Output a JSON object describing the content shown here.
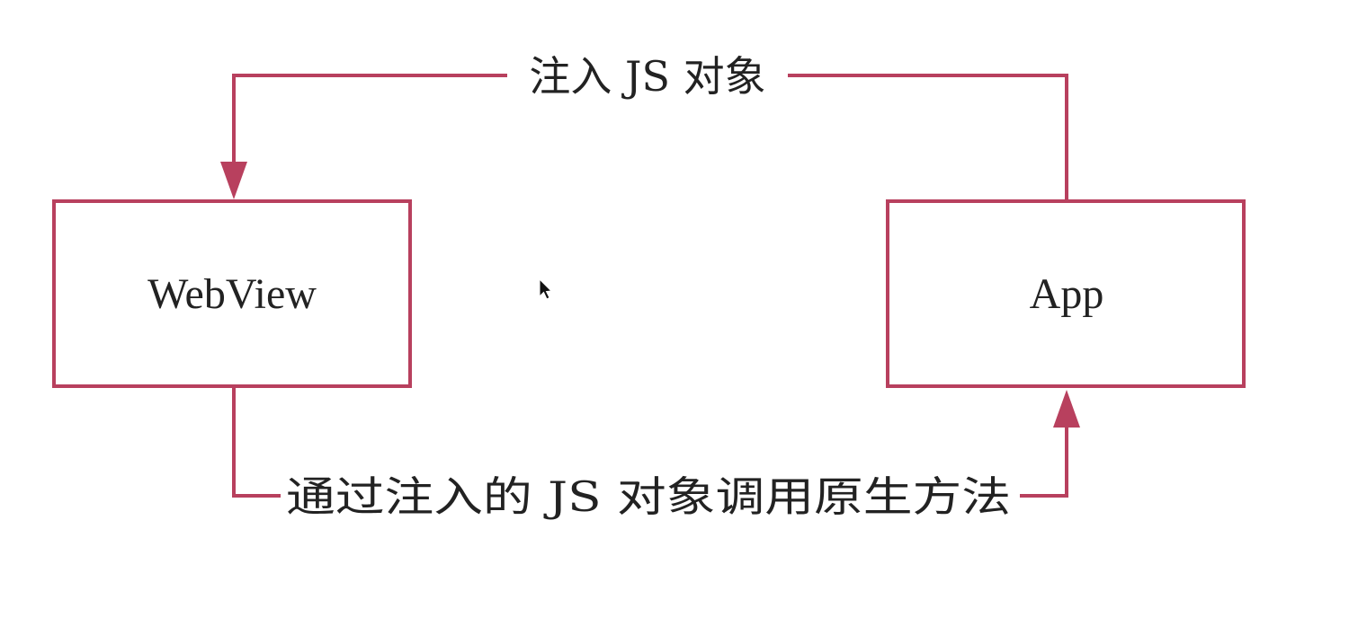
{
  "nodes": {
    "webview": {
      "label": "WebView"
    },
    "app": {
      "label": "App"
    }
  },
  "edges": {
    "inject": {
      "label": "注入 JS 对象"
    },
    "invoke": {
      "label": "通过注入的 JS 对象调用原生方法"
    }
  },
  "colors": {
    "stroke": "#b8405e",
    "text": "#222222",
    "background": "#ffffff"
  },
  "icons": {
    "cursor": "mouse-pointer-icon"
  }
}
